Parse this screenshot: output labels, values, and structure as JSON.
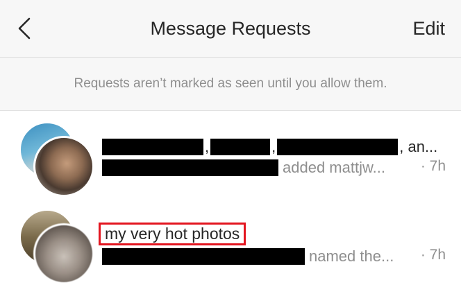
{
  "header": {
    "title": "Message Requests",
    "edit_label": "Edit",
    "back_icon": "chevron-left-icon"
  },
  "notice": {
    "text": "Requests aren’t marked as seen until you allow them."
  },
  "requests": [
    {
      "line1_separators": [
        ",",
        ",",
        ", an..."
      ],
      "line2_text": "added mattjw...",
      "time": "· 7h"
    },
    {
      "group_name": "my very hot  photos",
      "line2_text": "named the...",
      "time": "· 7h"
    }
  ],
  "colors": {
    "header_bg": "#f7f7f7",
    "secondary_text": "#8e8e8e",
    "highlight_border": "#e3151f",
    "redaction": "#000000"
  }
}
